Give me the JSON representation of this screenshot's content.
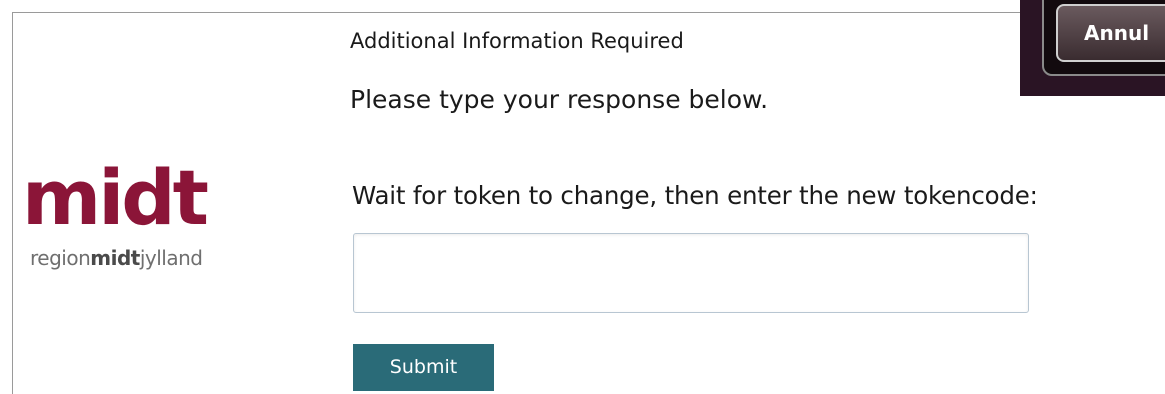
{
  "logo": {
    "word": "midt",
    "tagline_prefix": "region",
    "tagline_bold": "midt",
    "tagline_suffix": "jylland",
    "color": "#8b1538"
  },
  "form": {
    "title": "Additional Information Required",
    "instruction": "Please type your response below.",
    "field_label": "Wait for token to change, then enter the new tokencode:",
    "input_value": "",
    "submit_label": "Submit",
    "submit_color": "#2a6b78"
  },
  "overlay": {
    "button_label": "Annul"
  }
}
